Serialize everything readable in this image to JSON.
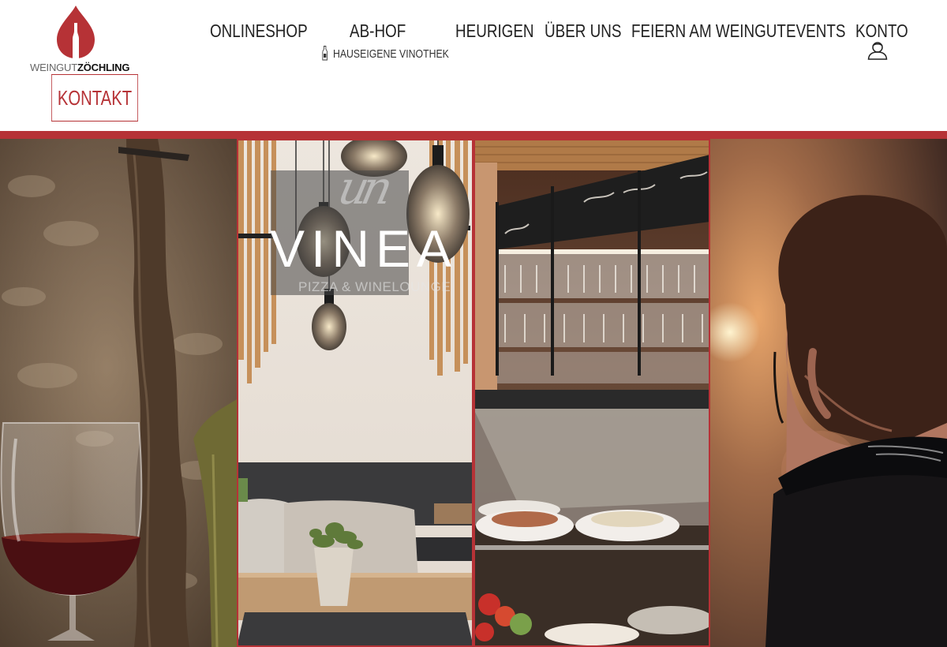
{
  "brand": {
    "wordmark_light": "WEINGUT",
    "wordmark_bold": "ZÖCHLING"
  },
  "kontakt_label": "KONTAKT",
  "nav": {
    "onlineshop": "ONLINESHOP",
    "ab_hof": "AB-HOF",
    "ab_hof_sub": "HAUSEIGENE VINOTHEK",
    "heurigen": "HEURIGEN",
    "ueber_uns": "ÜBER UNS",
    "feiern": "FEIERN AM WEINGUT",
    "events": "EVENTS",
    "konto": "KONTO"
  },
  "panels": [
    {
      "name": "wine-glass-vineyard"
    },
    {
      "name": "vinea-lounge",
      "script_mark": "un",
      "title": "VINEA",
      "subtitle": "PIZZA & WINELOUNGE"
    },
    {
      "name": "bar-buffet"
    },
    {
      "name": "events-person"
    }
  ],
  "icons": {
    "logo": "wine-drop-logo-icon",
    "bottle": "bottle-icon",
    "account": "user-icon"
  },
  "colors": {
    "accent": "#b63236",
    "text": "#222222"
  }
}
